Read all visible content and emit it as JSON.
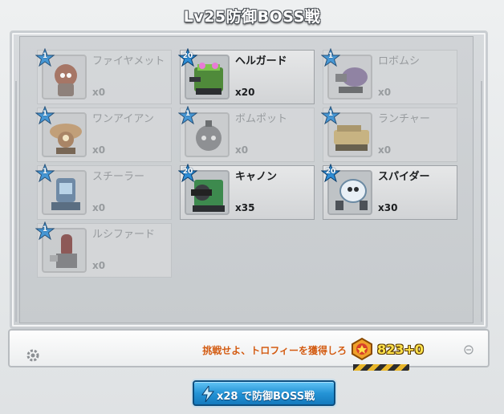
{
  "header": {
    "title": "Lv25防御BOSS戦"
  },
  "units": [
    {
      "level": "1",
      "name": "ファイヤメット",
      "count": "x0",
      "owned": false,
      "color": "#d0542c"
    },
    {
      "level": "20",
      "name": "ヘルガード",
      "count": "x20",
      "owned": true,
      "color": "#4f8a3a"
    },
    {
      "level": "1",
      "name": "ロボムシ",
      "count": "x0",
      "owned": false,
      "color": "#8a6ab7"
    },
    {
      "level": "1",
      "name": "ワンアイアン",
      "count": "x0",
      "owned": false,
      "color": "#e0892a"
    },
    {
      "level": "1",
      "name": "ボムポット",
      "count": "x0",
      "owned": false,
      "color": "#7d7f84"
    },
    {
      "level": "1",
      "name": "ランチャー",
      "count": "x0",
      "owned": false,
      "color": "#d7a52a"
    },
    {
      "level": "1",
      "name": "スチーラー",
      "count": "x0",
      "owned": false,
      "color": "#3a7ec2"
    },
    {
      "level": "20",
      "name": "キャノン",
      "count": "x35",
      "owned": true,
      "color": "#3d8a4e"
    },
    {
      "level": "20",
      "name": "スパイダー",
      "count": "x30",
      "owned": true,
      "color": "#a9c6dc"
    },
    {
      "level": "1",
      "name": "ルシファード",
      "count": "x0",
      "owned": false,
      "color": "#b6332d"
    }
  ],
  "footer": {
    "message": "挑戦せよ、トロフィーを獲得しろ",
    "trophy_count": "823+0"
  },
  "action": {
    "label": "x28 で防御BOSS戦"
  },
  "colors": {
    "accent": "#2594d6",
    "star": "#2f8ed6",
    "warning_text": "#d25b12",
    "trophy": "#ffe24a"
  }
}
